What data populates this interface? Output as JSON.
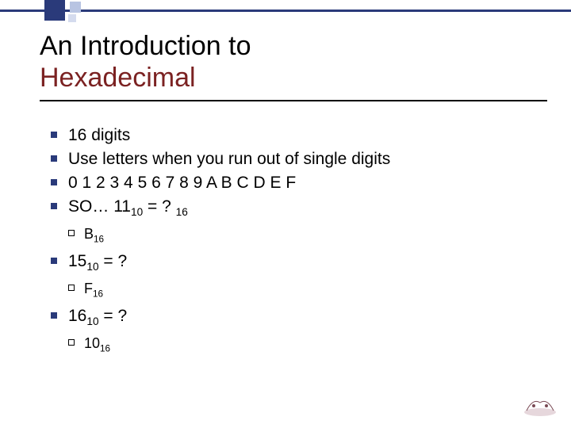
{
  "title": {
    "line1": "An Introduction to",
    "line2": "Hexadecimal"
  },
  "bullets": [
    {
      "text": "16 digits"
    },
    {
      "text": "Use letters when you run out of single digits"
    },
    {
      "text": "0 1 2 3 4 5 6 7 8 9 A B C D E F"
    },
    {
      "prefix": "SO…  ",
      "value": "11",
      "value_sub": "10",
      "mid": " = ? ",
      "q_sub": "16",
      "sub_answer": {
        "val": "B",
        "sub": "16"
      }
    },
    {
      "value": "15",
      "value_sub": "10",
      "mid": " = ?",
      "sub_answer": {
        "val": "F",
        "sub": "16"
      }
    },
    {
      "value": "16",
      "value_sub": "10",
      "mid": " = ?",
      "sub_answer": {
        "val": "10",
        "sub": "16"
      }
    }
  ]
}
